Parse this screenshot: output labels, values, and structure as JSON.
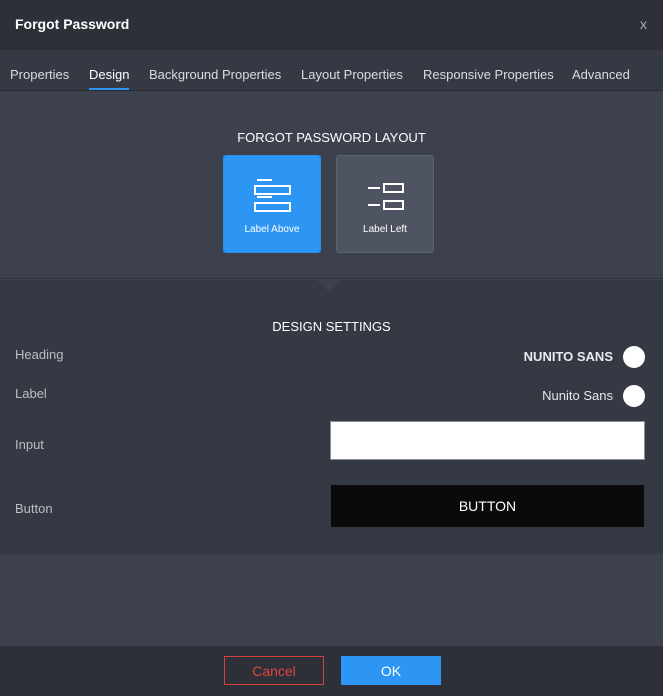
{
  "dialog": {
    "title": "Forgot Password",
    "close_label": "x"
  },
  "tabs": [
    {
      "label": "Properties",
      "active": false
    },
    {
      "label": "Design",
      "active": true
    },
    {
      "label": "Background Properties",
      "active": false
    },
    {
      "label": "Layout Properties",
      "active": false
    },
    {
      "label": "Responsive Properties",
      "active": false
    },
    {
      "label": "Advanced",
      "active": false
    }
  ],
  "layout": {
    "title": "FORGOT PASSWORD LAYOUT",
    "options": [
      {
        "label": "Label Above",
        "icon": "label-above-icon",
        "selected": true
      },
      {
        "label": "Label Left",
        "icon": "label-left-icon",
        "selected": false
      }
    ]
  },
  "design": {
    "title": "DESIGN SETTINGS",
    "heading": {
      "label": "Heading",
      "font": "NUNITO SANS",
      "color": "#ffffff"
    },
    "label": {
      "label": "Label",
      "font": "Nunito Sans",
      "color": "#ffffff"
    },
    "input": {
      "label": "Input"
    },
    "button": {
      "label": "Button",
      "text": "BUTTON"
    }
  },
  "footer": {
    "cancel_label": "Cancel",
    "ok_label": "OK"
  },
  "colors": {
    "accent": "#2d96f5",
    "danger": "#e0463d",
    "background": "#3c414d",
    "header": "#2d3039"
  }
}
